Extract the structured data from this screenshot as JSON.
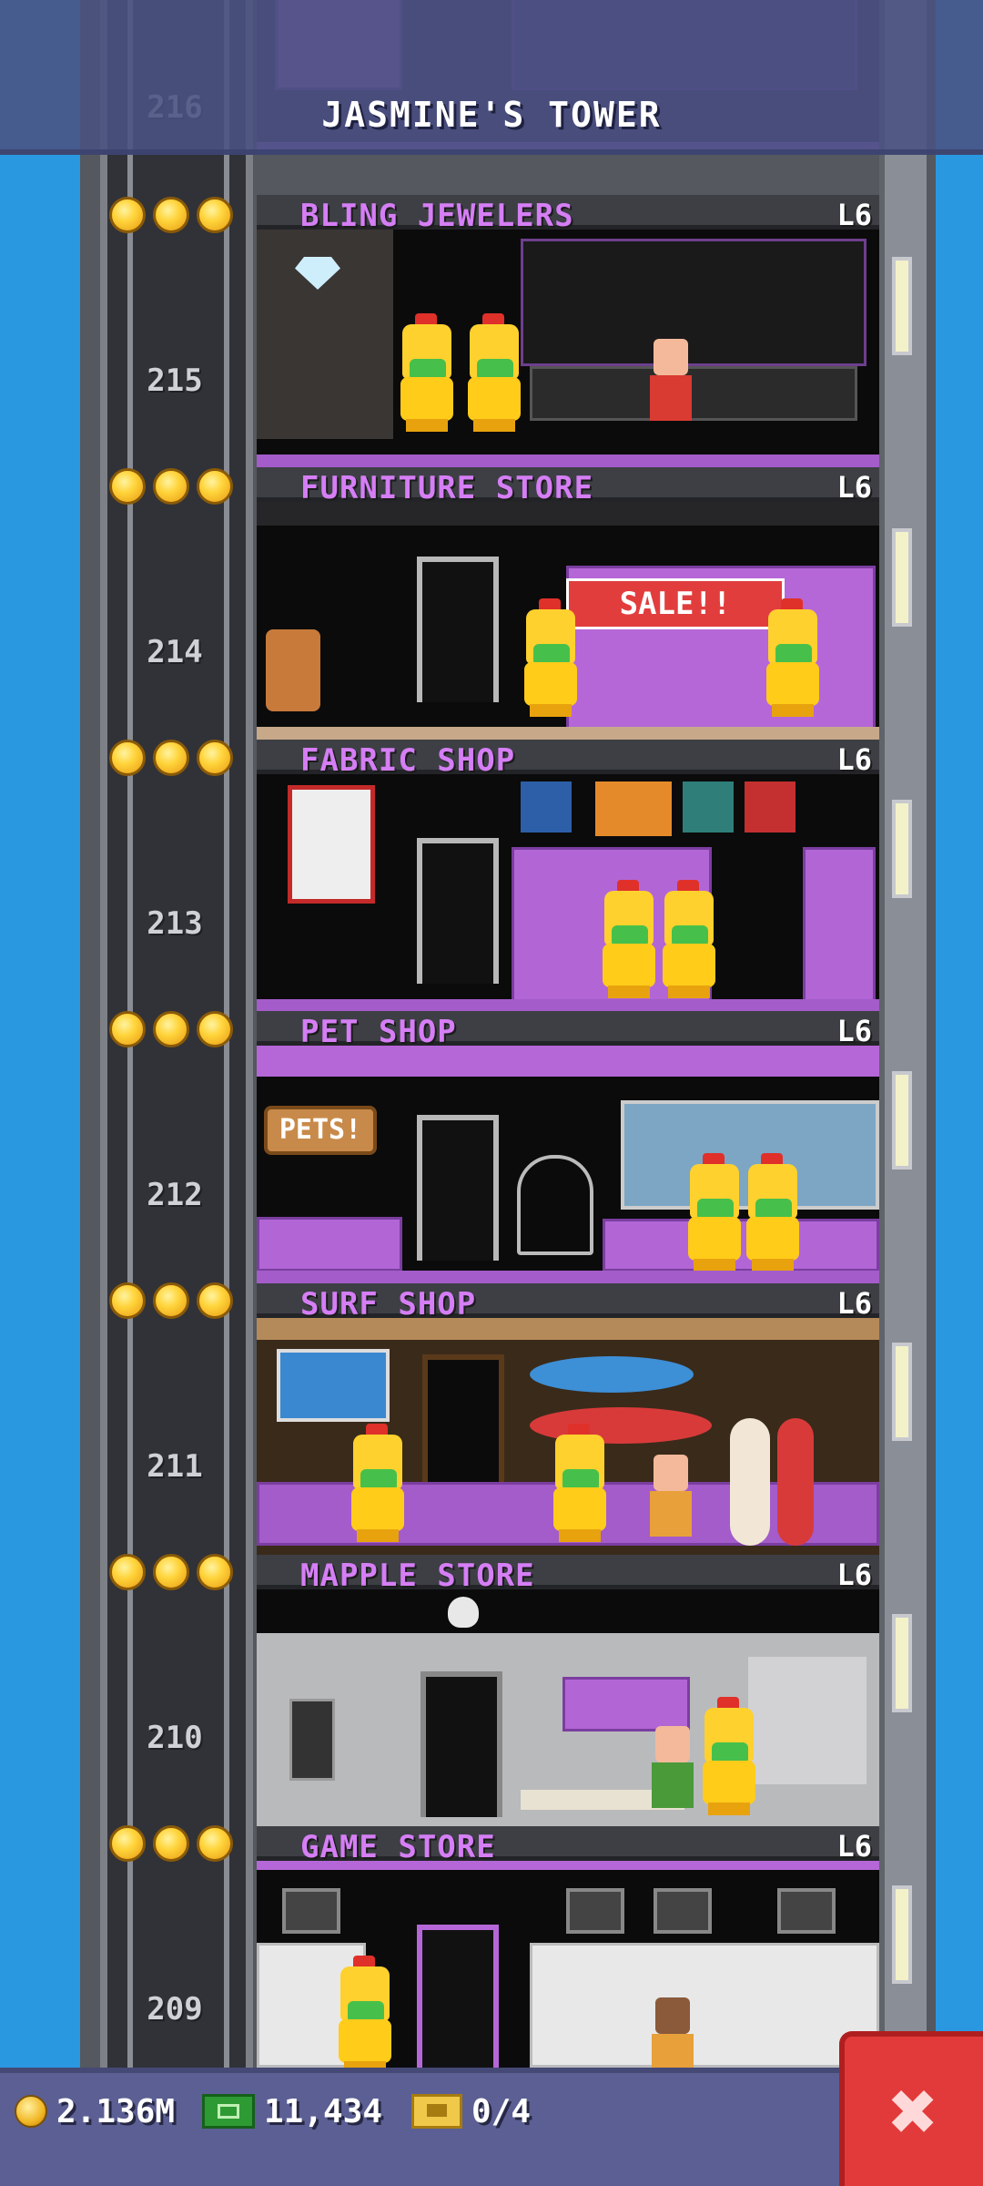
{
  "header": {
    "title": "JASMINE'S TOWER",
    "top_floor_number": "216"
  },
  "floors": [
    {
      "number": "215",
      "name": "BLING JEWELERS",
      "level": "L6",
      "stars": 3
    },
    {
      "number": "214",
      "name": "FURNITURE STORE",
      "level": "L6",
      "stars": 3,
      "sign": "SALE!!"
    },
    {
      "number": "213",
      "name": "FABRIC SHOP",
      "level": "L6",
      "stars": 3
    },
    {
      "number": "212",
      "name": "PET SHOP",
      "level": "L6",
      "stars": 3,
      "sign": "PETS!"
    },
    {
      "number": "211",
      "name": "SURF SHOP",
      "level": "L6",
      "stars": 3
    },
    {
      "number": "210",
      "name": "MAPPLE STORE",
      "level": "L6",
      "stars": 3
    },
    {
      "number": "209",
      "name": "GAME STORE",
      "level": "L6",
      "stars": 3
    }
  ],
  "status_bar": {
    "coins": "2.136M",
    "bux": "11,434",
    "tickets": "0/4"
  },
  "colors": {
    "sky": "#2a98e0",
    "floor_name": "#d57ef5",
    "close_button": "#e23a3a"
  }
}
